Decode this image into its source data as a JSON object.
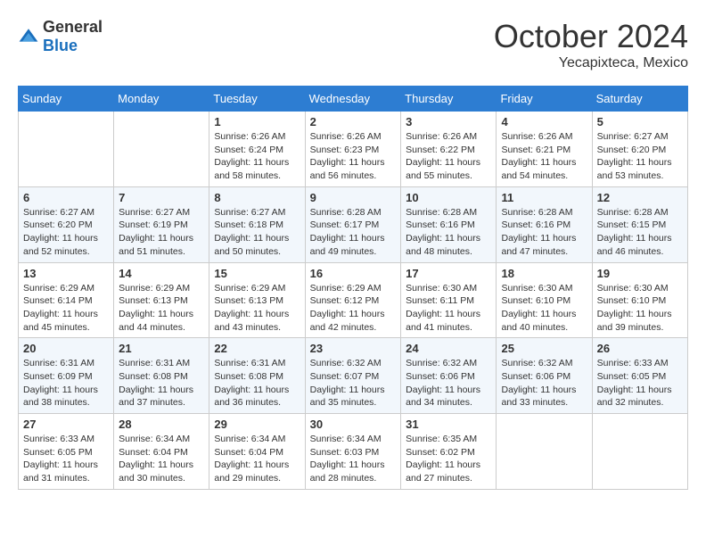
{
  "header": {
    "logo_general": "General",
    "logo_blue": "Blue",
    "month_title": "October 2024",
    "location": "Yecapixteca, Mexico"
  },
  "columns": [
    "Sunday",
    "Monday",
    "Tuesday",
    "Wednesday",
    "Thursday",
    "Friday",
    "Saturday"
  ],
  "weeks": [
    [
      {
        "day": "",
        "sunrise": "",
        "sunset": "",
        "daylight": ""
      },
      {
        "day": "",
        "sunrise": "",
        "sunset": "",
        "daylight": ""
      },
      {
        "day": "1",
        "sunrise": "Sunrise: 6:26 AM",
        "sunset": "Sunset: 6:24 PM",
        "daylight": "Daylight: 11 hours and 58 minutes."
      },
      {
        "day": "2",
        "sunrise": "Sunrise: 6:26 AM",
        "sunset": "Sunset: 6:23 PM",
        "daylight": "Daylight: 11 hours and 56 minutes."
      },
      {
        "day": "3",
        "sunrise": "Sunrise: 6:26 AM",
        "sunset": "Sunset: 6:22 PM",
        "daylight": "Daylight: 11 hours and 55 minutes."
      },
      {
        "day": "4",
        "sunrise": "Sunrise: 6:26 AM",
        "sunset": "Sunset: 6:21 PM",
        "daylight": "Daylight: 11 hours and 54 minutes."
      },
      {
        "day": "5",
        "sunrise": "Sunrise: 6:27 AM",
        "sunset": "Sunset: 6:20 PM",
        "daylight": "Daylight: 11 hours and 53 minutes."
      }
    ],
    [
      {
        "day": "6",
        "sunrise": "Sunrise: 6:27 AM",
        "sunset": "Sunset: 6:20 PM",
        "daylight": "Daylight: 11 hours and 52 minutes."
      },
      {
        "day": "7",
        "sunrise": "Sunrise: 6:27 AM",
        "sunset": "Sunset: 6:19 PM",
        "daylight": "Daylight: 11 hours and 51 minutes."
      },
      {
        "day": "8",
        "sunrise": "Sunrise: 6:27 AM",
        "sunset": "Sunset: 6:18 PM",
        "daylight": "Daylight: 11 hours and 50 minutes."
      },
      {
        "day": "9",
        "sunrise": "Sunrise: 6:28 AM",
        "sunset": "Sunset: 6:17 PM",
        "daylight": "Daylight: 11 hours and 49 minutes."
      },
      {
        "day": "10",
        "sunrise": "Sunrise: 6:28 AM",
        "sunset": "Sunset: 6:16 PM",
        "daylight": "Daylight: 11 hours and 48 minutes."
      },
      {
        "day": "11",
        "sunrise": "Sunrise: 6:28 AM",
        "sunset": "Sunset: 6:16 PM",
        "daylight": "Daylight: 11 hours and 47 minutes."
      },
      {
        "day": "12",
        "sunrise": "Sunrise: 6:28 AM",
        "sunset": "Sunset: 6:15 PM",
        "daylight": "Daylight: 11 hours and 46 minutes."
      }
    ],
    [
      {
        "day": "13",
        "sunrise": "Sunrise: 6:29 AM",
        "sunset": "Sunset: 6:14 PM",
        "daylight": "Daylight: 11 hours and 45 minutes."
      },
      {
        "day": "14",
        "sunrise": "Sunrise: 6:29 AM",
        "sunset": "Sunset: 6:13 PM",
        "daylight": "Daylight: 11 hours and 44 minutes."
      },
      {
        "day": "15",
        "sunrise": "Sunrise: 6:29 AM",
        "sunset": "Sunset: 6:13 PM",
        "daylight": "Daylight: 11 hours and 43 minutes."
      },
      {
        "day": "16",
        "sunrise": "Sunrise: 6:29 AM",
        "sunset": "Sunset: 6:12 PM",
        "daylight": "Daylight: 11 hours and 42 minutes."
      },
      {
        "day": "17",
        "sunrise": "Sunrise: 6:30 AM",
        "sunset": "Sunset: 6:11 PM",
        "daylight": "Daylight: 11 hours and 41 minutes."
      },
      {
        "day": "18",
        "sunrise": "Sunrise: 6:30 AM",
        "sunset": "Sunset: 6:10 PM",
        "daylight": "Daylight: 11 hours and 40 minutes."
      },
      {
        "day": "19",
        "sunrise": "Sunrise: 6:30 AM",
        "sunset": "Sunset: 6:10 PM",
        "daylight": "Daylight: 11 hours and 39 minutes."
      }
    ],
    [
      {
        "day": "20",
        "sunrise": "Sunrise: 6:31 AM",
        "sunset": "Sunset: 6:09 PM",
        "daylight": "Daylight: 11 hours and 38 minutes."
      },
      {
        "day": "21",
        "sunrise": "Sunrise: 6:31 AM",
        "sunset": "Sunset: 6:08 PM",
        "daylight": "Daylight: 11 hours and 37 minutes."
      },
      {
        "day": "22",
        "sunrise": "Sunrise: 6:31 AM",
        "sunset": "Sunset: 6:08 PM",
        "daylight": "Daylight: 11 hours and 36 minutes."
      },
      {
        "day": "23",
        "sunrise": "Sunrise: 6:32 AM",
        "sunset": "Sunset: 6:07 PM",
        "daylight": "Daylight: 11 hours and 35 minutes."
      },
      {
        "day": "24",
        "sunrise": "Sunrise: 6:32 AM",
        "sunset": "Sunset: 6:06 PM",
        "daylight": "Daylight: 11 hours and 34 minutes."
      },
      {
        "day": "25",
        "sunrise": "Sunrise: 6:32 AM",
        "sunset": "Sunset: 6:06 PM",
        "daylight": "Daylight: 11 hours and 33 minutes."
      },
      {
        "day": "26",
        "sunrise": "Sunrise: 6:33 AM",
        "sunset": "Sunset: 6:05 PM",
        "daylight": "Daylight: 11 hours and 32 minutes."
      }
    ],
    [
      {
        "day": "27",
        "sunrise": "Sunrise: 6:33 AM",
        "sunset": "Sunset: 6:05 PM",
        "daylight": "Daylight: 11 hours and 31 minutes."
      },
      {
        "day": "28",
        "sunrise": "Sunrise: 6:34 AM",
        "sunset": "Sunset: 6:04 PM",
        "daylight": "Daylight: 11 hours and 30 minutes."
      },
      {
        "day": "29",
        "sunrise": "Sunrise: 6:34 AM",
        "sunset": "Sunset: 6:04 PM",
        "daylight": "Daylight: 11 hours and 29 minutes."
      },
      {
        "day": "30",
        "sunrise": "Sunrise: 6:34 AM",
        "sunset": "Sunset: 6:03 PM",
        "daylight": "Daylight: 11 hours and 28 minutes."
      },
      {
        "day": "31",
        "sunrise": "Sunrise: 6:35 AM",
        "sunset": "Sunset: 6:02 PM",
        "daylight": "Daylight: 11 hours and 27 minutes."
      },
      {
        "day": "",
        "sunrise": "",
        "sunset": "",
        "daylight": ""
      },
      {
        "day": "",
        "sunrise": "",
        "sunset": "",
        "daylight": ""
      }
    ]
  ]
}
